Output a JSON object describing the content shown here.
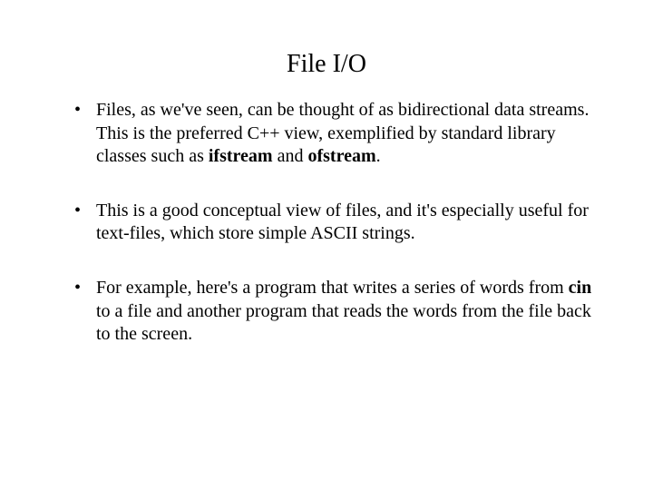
{
  "title": "File I/O",
  "bullets": {
    "b0": {
      "p1": "Files, as we've seen, can be thought of as bidirectional data streams.  This is the preferred C++ view, exemplified by standard library classes such as ",
      "c1": "ifstream",
      "p2": " and ",
      "c2": "ofstream",
      "p3": "."
    },
    "b1": "This is a good conceptual view of files, and it's especially useful for text-files, which store simple ASCII strings.",
    "b2": {
      "p1": "For example, here's a program that writes a series of words from ",
      "c1": "cin",
      "p2": " to a file and another program that reads the words from the file back to the screen."
    }
  }
}
